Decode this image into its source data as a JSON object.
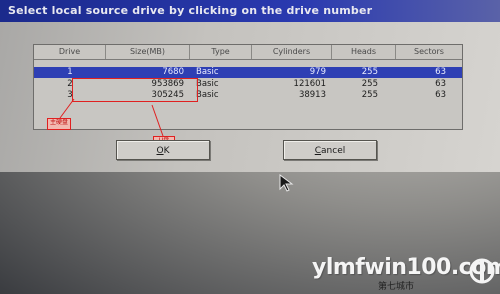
{
  "window": {
    "title": "Select local source drive by clicking on the drive number"
  },
  "table": {
    "columns": [
      "Drive",
      "Size(MB)",
      "Type",
      "Cylinders",
      "Heads",
      "Sectors"
    ],
    "rows": [
      {
        "drive": "1",
        "size": "7680",
        "type": "Basic",
        "cylinders": "979",
        "heads": "255",
        "sectors": "63"
      },
      {
        "drive": "2",
        "size": "953869",
        "type": "Basic",
        "cylinders": "121601",
        "heads": "255",
        "sectors": "63"
      },
      {
        "drive": "3",
        "size": "305245",
        "type": "Basic",
        "cylinders": "38913",
        "heads": "255",
        "sectors": "63"
      }
    ],
    "selected_row": 1
  },
  "annotations": {
    "label_left": "主硬盘",
    "label_right": "U盘"
  },
  "buttons": {
    "ok_hotkey": "O",
    "ok_rest": "K",
    "cancel_hotkey": "C",
    "cancel_rest": "ancel"
  },
  "watermark": {
    "text": "ylmfwin100.com",
    "subtext": "第七城市"
  },
  "colors": {
    "selection": "#2e3fb4",
    "annotation": "#e02020",
    "title_bar": "#1b2a8c"
  }
}
